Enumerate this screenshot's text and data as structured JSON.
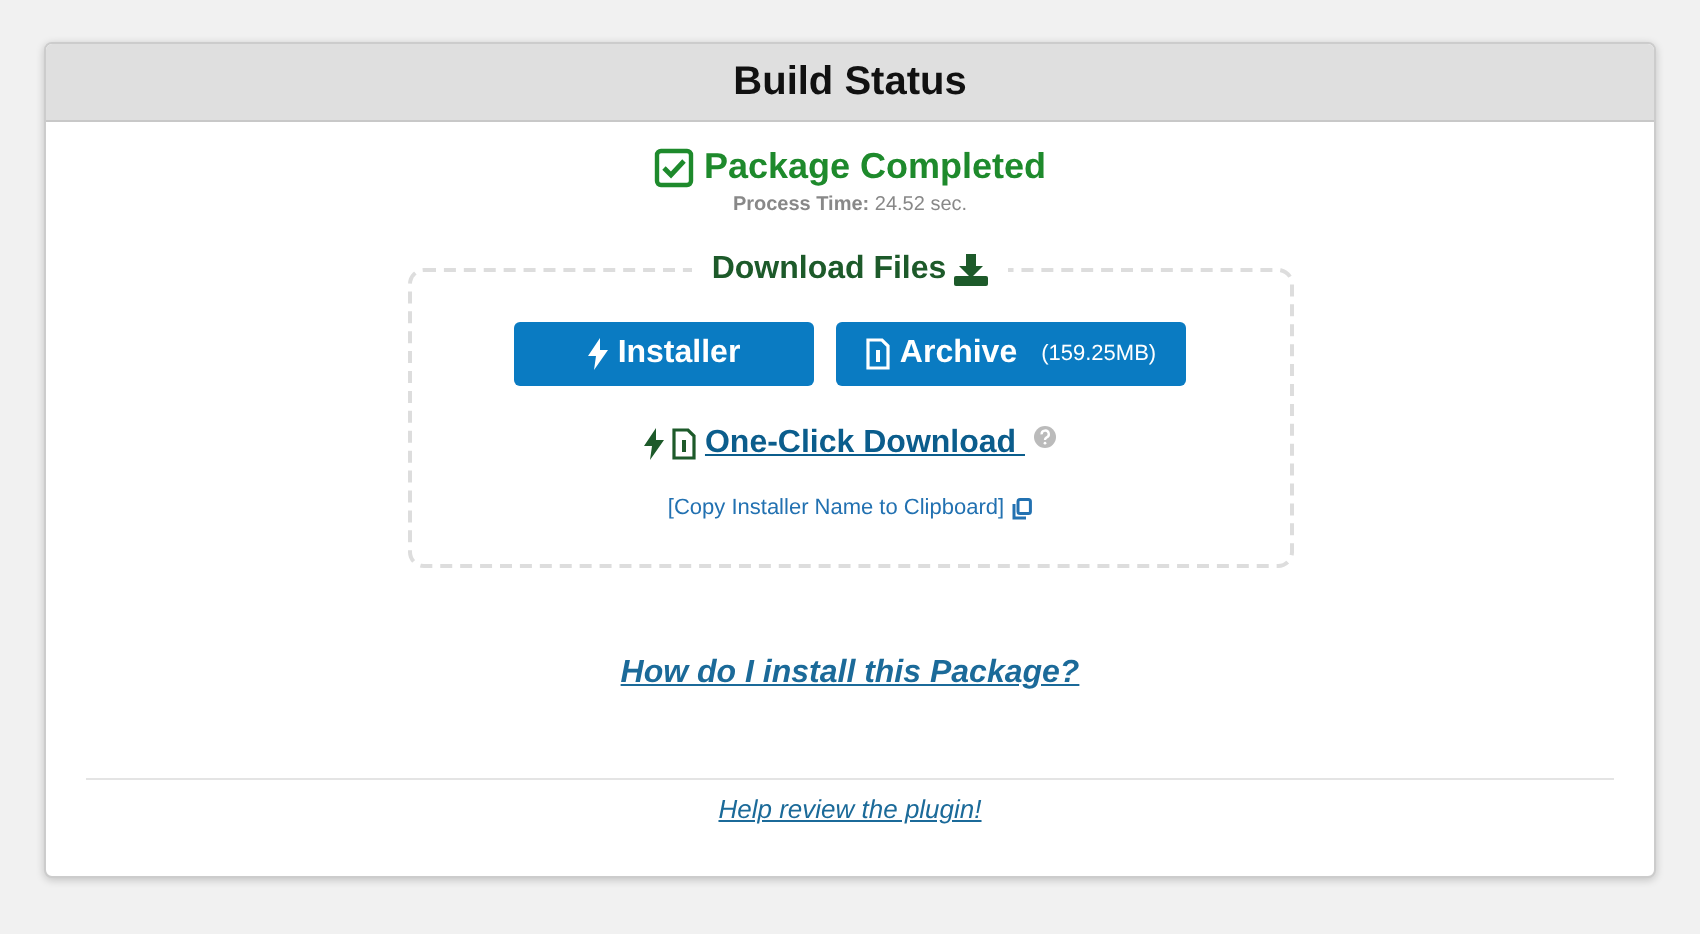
{
  "panel": {
    "title": "Build Status"
  },
  "status": {
    "text": "Package Completed",
    "detail": "**Process Time:** 24.52 sec."
  },
  "download": {
    "legend": "Download Files",
    "buttons": [
      {
        "kind": "installer",
        "label": "Installer"
      },
      {
        "kind": "archive",
        "label": "Archive",
        "size": "(159.25MB)"
      }
    ],
    "one_click": "One-Click Download ",
    "copy_link": "[Copy Installer Name to Clipboard]"
  },
  "install_link": "How do I install this Package?",
  "footer_link": "Help review the plugin!"
}
